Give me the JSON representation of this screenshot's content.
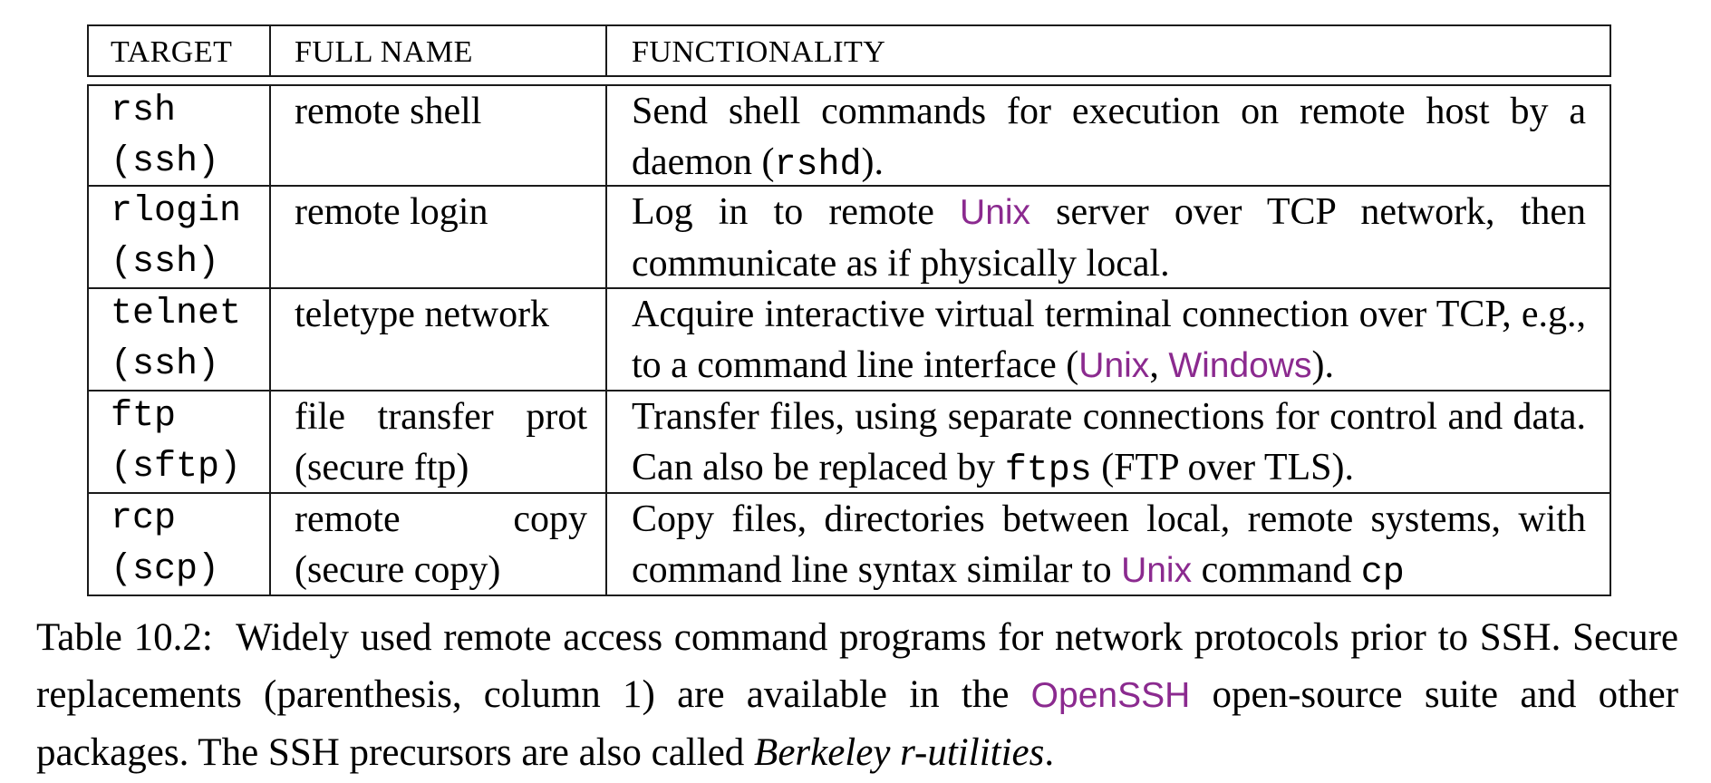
{
  "table": {
    "headers": [
      "TARGET",
      "FULL NAME",
      "FUNCTIONALITY"
    ],
    "link_color": "#8b2a8f",
    "rows": [
      {
        "target": "rsh",
        "replacement": "(ssh)",
        "full_name": [
          "remote shell"
        ],
        "functionality": [
          {
            "t": "text",
            "v": "Send shell commands for execution on remote host by a daemon ("
          },
          {
            "t": "mono",
            "v": "rshd"
          },
          {
            "t": "text",
            "v": ")."
          }
        ]
      },
      {
        "target": "rlogin",
        "replacement": "(ssh)",
        "full_name": [
          "remote login"
        ],
        "functionality": [
          {
            "t": "text",
            "v": "Log in to remote "
          },
          {
            "t": "link",
            "v": "Unix"
          },
          {
            "t": "text",
            "v": " server over TCP network, then communicate as if physically local."
          }
        ]
      },
      {
        "target": "telnet",
        "replacement": "(ssh)",
        "full_name": [
          "teletype network"
        ],
        "functionality": [
          {
            "t": "text",
            "v": "Acquire interactive virtual terminal connection over TCP, e.g., to a command line interface ("
          },
          {
            "t": "link",
            "v": "Unix"
          },
          {
            "t": "text",
            "v": ", "
          },
          {
            "t": "link",
            "v": "Windows"
          },
          {
            "t": "text",
            "v": ")."
          }
        ]
      },
      {
        "target": "ftp",
        "replacement": "(sftp)",
        "full_name": [
          "file transfer prot",
          "(secure ftp)"
        ],
        "functionality": [
          {
            "t": "text",
            "v": "Transfer files, using separate connections for control and data. Can also be replaced by "
          },
          {
            "t": "mono",
            "v": "ftps"
          },
          {
            "t": "text",
            "v": " (FTP over TLS)."
          }
        ]
      },
      {
        "target": "rcp",
        "replacement": "(scp)",
        "full_name": [
          "remote copy",
          "(secure copy)"
        ],
        "functionality": [
          {
            "t": "text",
            "v": "Copy files, directories between local, remote systems, with command line syntax similar to "
          },
          {
            "t": "link",
            "v": "Unix"
          },
          {
            "t": "text",
            "v": " command "
          },
          {
            "t": "mono",
            "v": "cp"
          }
        ]
      }
    ]
  },
  "caption": {
    "label": "Table 10.2:",
    "segments": [
      {
        "t": "text",
        "v": "Widely used remote access command programs for network protocols prior to SSH. Secure replacements (parenthesis, column 1) are available in the "
      },
      {
        "t": "link",
        "v": "OpenSSH"
      },
      {
        "t": "text",
        "v": " open-source suite and other packages. The SSH precursors are also called "
      },
      {
        "t": "em",
        "v": "Berkeley r-utilities"
      },
      {
        "t": "text",
        "v": "."
      }
    ]
  }
}
